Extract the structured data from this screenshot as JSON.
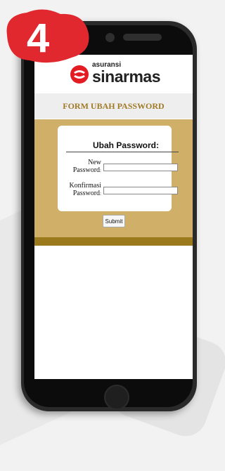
{
  "step_badge": {
    "number": "4",
    "color": "#e0282e"
  },
  "logo": {
    "small": "asuransi",
    "big": "sinarmas",
    "mark_color": "#e31b23"
  },
  "form": {
    "header": "FORM UBAH PASSWORD",
    "title": "Ubah Password:",
    "new_password_label_1": "New",
    "new_password_label_2": "Password",
    "confirm_label_1": "Konfirmasi",
    "confirm_label_2": "Password",
    "colon": ":",
    "new_password_value": "",
    "confirm_value": "",
    "submit_label": "Submit"
  },
  "colors": {
    "header_text": "#a07a26",
    "panel": "#d0b068",
    "panel_bottom": "#9b7a1e"
  }
}
